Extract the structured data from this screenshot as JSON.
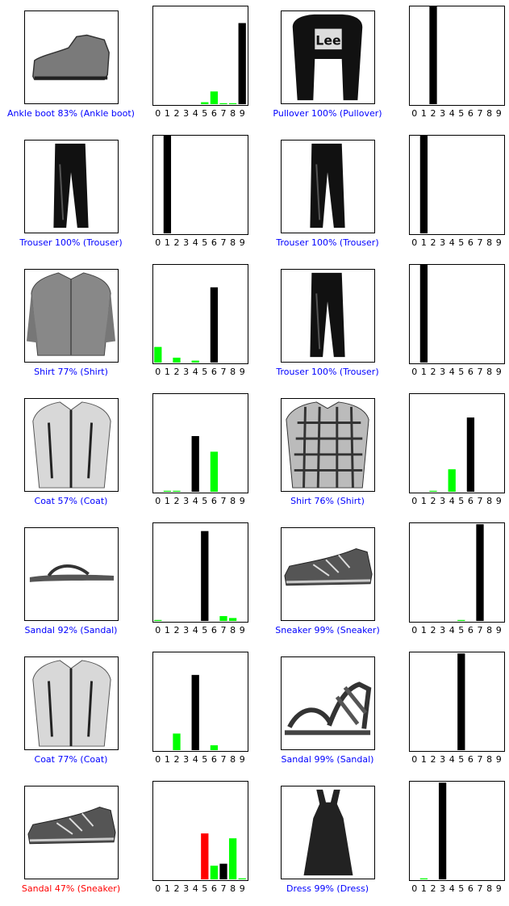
{
  "colors": {
    "correct": "#0000ff",
    "wrong": "#ff0000",
    "true_bar": "#000000",
    "pred_bar_wrong": "#ff0000",
    "other_bar": "#00ff00"
  },
  "panels": [
    {
      "item": "ankle-boot",
      "caption": "Ankle boot 83% (Ankle boot)",
      "caption_color": "#0000ff",
      "true": 9,
      "pred": 9
    },
    {
      "item": "pullover",
      "caption": "Pullover 100% (Pullover)",
      "caption_color": "#0000ff",
      "true": 2,
      "pred": 2
    },
    {
      "item": "trouser",
      "caption": "Trouser 100% (Trouser)",
      "caption_color": "#0000ff",
      "true": 1,
      "pred": 1
    },
    {
      "item": "trouser",
      "caption": "Trouser 100% (Trouser)",
      "caption_color": "#0000ff",
      "true": 1,
      "pred": 1
    },
    {
      "item": "shirt",
      "caption": "Shirt 77% (Shirt)",
      "caption_color": "#0000ff",
      "true": 6,
      "pred": 6
    },
    {
      "item": "trouser",
      "caption": "Trouser 100% (Trouser)",
      "caption_color": "#0000ff",
      "true": 1,
      "pred": 1
    },
    {
      "item": "coat",
      "caption": "Coat 57% (Coat)",
      "caption_color": "#0000ff",
      "true": 4,
      "pred": 4
    },
    {
      "item": "shirt-plaid",
      "caption": "Shirt 76% (Shirt)",
      "caption_color": "#0000ff",
      "true": 6,
      "pred": 6
    },
    {
      "item": "sandal",
      "caption": "Sandal 92% (Sandal)",
      "caption_color": "#0000ff",
      "true": 5,
      "pred": 5
    },
    {
      "item": "sneaker",
      "caption": "Sneaker 99% (Sneaker)",
      "caption_color": "#0000ff",
      "true": 7,
      "pred": 7
    },
    {
      "item": "coat",
      "caption": "Coat 77% (Coat)",
      "caption_color": "#0000ff",
      "true": 4,
      "pred": 4
    },
    {
      "item": "sandal-strappy",
      "caption": "Sandal 99% (Sandal)",
      "caption_color": "#0000ff",
      "true": 5,
      "pred": 5
    },
    {
      "item": "sneaker",
      "caption": "Sandal 47% (Sneaker)",
      "caption_color": "#ff0000",
      "true": 7,
      "pred": 5
    },
    {
      "item": "dress",
      "caption": "Dress 99% (Dress)",
      "caption_color": "#0000ff",
      "true": 3,
      "pred": 3
    }
  ],
  "chart_data": [
    {
      "type": "bar",
      "categories": [
        "0",
        "1",
        "2",
        "3",
        "4",
        "5",
        "6",
        "7",
        "8",
        "9"
      ],
      "ylim": [
        0,
        1
      ],
      "grid": false,
      "values": [
        0,
        0,
        0,
        0,
        0,
        0.02,
        0.13,
        0.01,
        0.01,
        0.83
      ],
      "bar_colors": [
        "#00ff00",
        "#00ff00",
        "#00ff00",
        "#00ff00",
        "#00ff00",
        "#00ff00",
        "#00ff00",
        "#00ff00",
        "#00ff00",
        "#000000"
      ]
    },
    {
      "type": "bar",
      "categories": [
        "0",
        "1",
        "2",
        "3",
        "4",
        "5",
        "6",
        "7",
        "8",
        "9"
      ],
      "ylim": [
        0,
        1
      ],
      "grid": false,
      "values": [
        0,
        0,
        1.0,
        0,
        0,
        0,
        0,
        0,
        0,
        0
      ],
      "bar_colors": [
        "#00ff00",
        "#00ff00",
        "#000000",
        "#00ff00",
        "#00ff00",
        "#00ff00",
        "#00ff00",
        "#00ff00",
        "#00ff00",
        "#00ff00"
      ]
    },
    {
      "type": "bar",
      "categories": [
        "0",
        "1",
        "2",
        "3",
        "4",
        "5",
        "6",
        "7",
        "8",
        "9"
      ],
      "ylim": [
        0,
        1
      ],
      "grid": false,
      "values": [
        0,
        1.0,
        0,
        0,
        0,
        0,
        0,
        0,
        0,
        0
      ],
      "bar_colors": [
        "#00ff00",
        "#000000",
        "#00ff00",
        "#00ff00",
        "#00ff00",
        "#00ff00",
        "#00ff00",
        "#00ff00",
        "#00ff00",
        "#00ff00"
      ]
    },
    {
      "type": "bar",
      "categories": [
        "0",
        "1",
        "2",
        "3",
        "4",
        "5",
        "6",
        "7",
        "8",
        "9"
      ],
      "ylim": [
        0,
        1
      ],
      "grid": false,
      "values": [
        0,
        1.0,
        0,
        0,
        0,
        0,
        0,
        0,
        0,
        0
      ],
      "bar_colors": [
        "#00ff00",
        "#000000",
        "#00ff00",
        "#00ff00",
        "#00ff00",
        "#00ff00",
        "#00ff00",
        "#00ff00",
        "#00ff00",
        "#00ff00"
      ]
    },
    {
      "type": "bar",
      "categories": [
        "0",
        "1",
        "2",
        "3",
        "4",
        "5",
        "6",
        "7",
        "8",
        "9"
      ],
      "ylim": [
        0,
        1
      ],
      "grid": false,
      "values": [
        0.16,
        0,
        0.05,
        0,
        0.02,
        0,
        0.77,
        0,
        0,
        0
      ],
      "bar_colors": [
        "#00ff00",
        "#00ff00",
        "#00ff00",
        "#00ff00",
        "#00ff00",
        "#00ff00",
        "#000000",
        "#00ff00",
        "#00ff00",
        "#00ff00"
      ]
    },
    {
      "type": "bar",
      "categories": [
        "0",
        "1",
        "2",
        "3",
        "4",
        "5",
        "6",
        "7",
        "8",
        "9"
      ],
      "ylim": [
        0,
        1
      ],
      "grid": false,
      "values": [
        0,
        1.0,
        0,
        0,
        0,
        0,
        0,
        0,
        0,
        0
      ],
      "bar_colors": [
        "#00ff00",
        "#000000",
        "#00ff00",
        "#00ff00",
        "#00ff00",
        "#00ff00",
        "#00ff00",
        "#00ff00",
        "#00ff00",
        "#00ff00"
      ]
    },
    {
      "type": "bar",
      "categories": [
        "0",
        "1",
        "2",
        "3",
        "4",
        "5",
        "6",
        "7",
        "8",
        "9"
      ],
      "ylim": [
        0,
        1
      ],
      "grid": false,
      "values": [
        0,
        0.01,
        0.01,
        0,
        0.57,
        0,
        0.41,
        0,
        0,
        0
      ],
      "bar_colors": [
        "#00ff00",
        "#00ff00",
        "#00ff00",
        "#00ff00",
        "#000000",
        "#00ff00",
        "#00ff00",
        "#00ff00",
        "#00ff00",
        "#00ff00"
      ]
    },
    {
      "type": "bar",
      "categories": [
        "0",
        "1",
        "2",
        "3",
        "4",
        "5",
        "6",
        "7",
        "8",
        "9"
      ],
      "ylim": [
        0,
        1
      ],
      "grid": false,
      "values": [
        0,
        0,
        0.01,
        0,
        0.23,
        0,
        0.76,
        0,
        0,
        0
      ],
      "bar_colors": [
        "#00ff00",
        "#00ff00",
        "#00ff00",
        "#00ff00",
        "#00ff00",
        "#00ff00",
        "#000000",
        "#00ff00",
        "#00ff00",
        "#00ff00"
      ]
    },
    {
      "type": "bar",
      "categories": [
        "0",
        "1",
        "2",
        "3",
        "4",
        "5",
        "6",
        "7",
        "8",
        "9"
      ],
      "ylim": [
        0,
        1
      ],
      "grid": false,
      "values": [
        0.01,
        0,
        0,
        0,
        0,
        0.92,
        0,
        0.05,
        0.03,
        0
      ],
      "bar_colors": [
        "#00ff00",
        "#00ff00",
        "#00ff00",
        "#00ff00",
        "#00ff00",
        "#000000",
        "#00ff00",
        "#00ff00",
        "#00ff00",
        "#00ff00"
      ]
    },
    {
      "type": "bar",
      "categories": [
        "0",
        "1",
        "2",
        "3",
        "4",
        "5",
        "6",
        "7",
        "8",
        "9"
      ],
      "ylim": [
        0,
        1
      ],
      "grid": false,
      "values": [
        0,
        0,
        0,
        0,
        0,
        0.01,
        0,
        0.99,
        0,
        0
      ],
      "bar_colors": [
        "#00ff00",
        "#00ff00",
        "#00ff00",
        "#00ff00",
        "#00ff00",
        "#00ff00",
        "#00ff00",
        "#000000",
        "#00ff00",
        "#00ff00"
      ]
    },
    {
      "type": "bar",
      "categories": [
        "0",
        "1",
        "2",
        "3",
        "4",
        "5",
        "6",
        "7",
        "8",
        "9"
      ],
      "ylim": [
        0,
        1
      ],
      "grid": false,
      "values": [
        0,
        0,
        0.17,
        0,
        0.77,
        0,
        0.05,
        0,
        0,
        0
      ],
      "bar_colors": [
        "#00ff00",
        "#00ff00",
        "#00ff00",
        "#00ff00",
        "#000000",
        "#00ff00",
        "#00ff00",
        "#00ff00",
        "#00ff00",
        "#00ff00"
      ]
    },
    {
      "type": "bar",
      "categories": [
        "0",
        "1",
        "2",
        "3",
        "4",
        "5",
        "6",
        "7",
        "8",
        "9"
      ],
      "ylim": [
        0,
        1
      ],
      "grid": false,
      "values": [
        0,
        0,
        0,
        0,
        0,
        0.99,
        0,
        0,
        0,
        0
      ],
      "bar_colors": [
        "#00ff00",
        "#00ff00",
        "#00ff00",
        "#00ff00",
        "#00ff00",
        "#000000",
        "#00ff00",
        "#00ff00",
        "#00ff00",
        "#00ff00"
      ]
    },
    {
      "type": "bar",
      "categories": [
        "0",
        "1",
        "2",
        "3",
        "4",
        "5",
        "6",
        "7",
        "8",
        "9"
      ],
      "ylim": [
        0,
        1
      ],
      "grid": false,
      "values": [
        0,
        0,
        0,
        0,
        0,
        0.47,
        0.14,
        0.16,
        0.42,
        0.01
      ],
      "bar_colors": [
        "#00ff00",
        "#00ff00",
        "#00ff00",
        "#00ff00",
        "#00ff00",
        "#ff0000",
        "#00ff00",
        "#000000",
        "#00ff00",
        "#00ff00"
      ]
    },
    {
      "type": "bar",
      "categories": [
        "0",
        "1",
        "2",
        "3",
        "4",
        "5",
        "6",
        "7",
        "8",
        "9"
      ],
      "ylim": [
        0,
        1
      ],
      "grid": false,
      "values": [
        0,
        0.01,
        0,
        0.99,
        0,
        0,
        0,
        0,
        0,
        0
      ],
      "bar_colors": [
        "#00ff00",
        "#00ff00",
        "#00ff00",
        "#000000",
        "#00ff00",
        "#00ff00",
        "#00ff00",
        "#00ff00",
        "#00ff00",
        "#00ff00"
      ]
    }
  ]
}
